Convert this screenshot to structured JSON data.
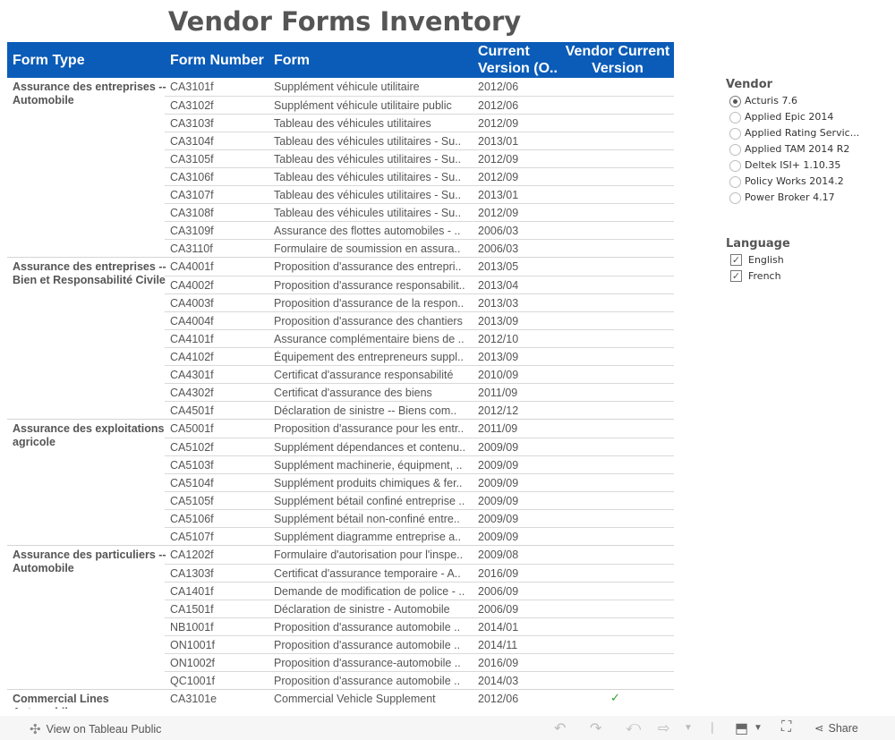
{
  "title": "Vendor Forms Inventory",
  "table": {
    "headers": {
      "form_type": "Form Type",
      "form_number": "Form Number",
      "form": "Form",
      "current_version": "Current Version (O..",
      "vendor_current_version": "Vendor Current Version"
    },
    "groups": [
      {
        "form_type": "Assurance des entreprises -- Automobile",
        "rows": [
          {
            "number": "CA3101f",
            "form": "Supplément véhicule utilitaire",
            "version": "2012/06",
            "vendor_current": ""
          },
          {
            "number": "CA3102f",
            "form": "Supplément véhicule utilitaire public",
            "version": "2012/06",
            "vendor_current": ""
          },
          {
            "number": "CA3103f",
            "form": "Tableau des véhicules utilitaires",
            "version": "2012/09",
            "vendor_current": ""
          },
          {
            "number": "CA3104f",
            "form": "Tableau des véhicules utilitaires - Su..",
            "version": "2013/01",
            "vendor_current": ""
          },
          {
            "number": "CA3105f",
            "form": "Tableau des véhicules utilitaires - Su..",
            "version": "2012/09",
            "vendor_current": ""
          },
          {
            "number": "CA3106f",
            "form": "Tableau des véhicules utilitaires - Su..",
            "version": "2012/09",
            "vendor_current": ""
          },
          {
            "number": "CA3107f",
            "form": "Tableau des véhicules utilitaires - Su..",
            "version": "2013/01",
            "vendor_current": ""
          },
          {
            "number": "CA3108f",
            "form": "Tableau des véhicules utilitaires - Su..",
            "version": "2012/09",
            "vendor_current": ""
          },
          {
            "number": "CA3109f",
            "form": "Assurance des flottes automobiles - ..",
            "version": "2006/03",
            "vendor_current": ""
          },
          {
            "number": "CA3110f",
            "form": "Formulaire de soumission en assura..",
            "version": "2006/03",
            "vendor_current": ""
          }
        ]
      },
      {
        "form_type": "Assurance des entreprises -- Bien et Responsabilité Civile",
        "rows": [
          {
            "number": "CA4001f",
            "form": "Proposition d'assurance des entrepri..",
            "version": "2013/05",
            "vendor_current": ""
          },
          {
            "number": "CA4002f",
            "form": "Proposition d'assurance responsabilit..",
            "version": "2013/04",
            "vendor_current": ""
          },
          {
            "number": "CA4003f",
            "form": "Proposition d'assurance de la respon..",
            "version": "2013/03",
            "vendor_current": ""
          },
          {
            "number": "CA4004f",
            "form": "Proposition d'assurance des chantiers",
            "version": "2013/09",
            "vendor_current": ""
          },
          {
            "number": "CA4101f",
            "form": "Assurance complémentaire biens de ..",
            "version": "2012/10",
            "vendor_current": ""
          },
          {
            "number": "CA4102f",
            "form": "Équipement des entrepreneurs suppl..",
            "version": "2013/09",
            "vendor_current": ""
          },
          {
            "number": "CA4301f",
            "form": "Certificat d'assurance responsabilité",
            "version": "2010/09",
            "vendor_current": ""
          },
          {
            "number": "CA4302f",
            "form": "Certificat d'assurance des biens",
            "version": "2011/09",
            "vendor_current": ""
          },
          {
            "number": "CA4501f",
            "form": "Déclaration de sinistre -- Biens com..",
            "version": "2012/12",
            "vendor_current": ""
          }
        ]
      },
      {
        "form_type": "Assurance des exploitations agricole",
        "rows": [
          {
            "number": "CA5001f",
            "form": "Proposition d'assurance pour les entr..",
            "version": "2011/09",
            "vendor_current": ""
          },
          {
            "number": "CA5102f",
            "form": "Supplément dépendances et contenu..",
            "version": "2009/09",
            "vendor_current": ""
          },
          {
            "number": "CA5103f",
            "form": "Supplément machinerie, équipment, ..",
            "version": "2009/09",
            "vendor_current": ""
          },
          {
            "number": "CA5104f",
            "form": "Supplément produits chimiques & fer..",
            "version": "2009/09",
            "vendor_current": ""
          },
          {
            "number": "CA5105f",
            "form": "Supplément bétail confiné entreprise ..",
            "version": "2009/09",
            "vendor_current": ""
          },
          {
            "number": "CA5106f",
            "form": "Supplément bétail non-confiné entre..",
            "version": "2009/09",
            "vendor_current": ""
          },
          {
            "number": "CA5107f",
            "form": "Supplément diagramme entreprise a..",
            "version": "2009/09",
            "vendor_current": ""
          }
        ]
      },
      {
        "form_type": "Assurance des particuliers -- Automobile",
        "rows": [
          {
            "number": "CA1202f",
            "form": "Formulaire d'autorisation pour l'inspe..",
            "version": "2009/08",
            "vendor_current": ""
          },
          {
            "number": "CA1303f",
            "form": "Certificat d'assurance temporaire - A..",
            "version": "2016/09",
            "vendor_current": ""
          },
          {
            "number": "CA1401f",
            "form": "Demande de modification de police - ..",
            "version": "2006/09",
            "vendor_current": ""
          },
          {
            "number": "CA1501f",
            "form": "Déclaration de sinistre - Automobile",
            "version": "2006/09",
            "vendor_current": ""
          },
          {
            "number": "NB1001f",
            "form": "Proposition d'assurance automobile ..",
            "version": "2014/01",
            "vendor_current": ""
          },
          {
            "number": "ON1001f",
            "form": "Proposition d'assurance automobile ..",
            "version": "2014/11",
            "vendor_current": ""
          },
          {
            "number": "ON1002f",
            "form": "Proposition d'assurance-automobile ..",
            "version": "2016/09",
            "vendor_current": ""
          },
          {
            "number": "QC1001f",
            "form": "Proposition d'assurance automobile ..",
            "version": "2014/03",
            "vendor_current": ""
          }
        ]
      },
      {
        "form_type": "Commercial Lines Automobile",
        "rows": [
          {
            "number": "CA3101e",
            "form": "Commercial Vehicle Supplement",
            "version": "2012/06",
            "vendor_current": "✓"
          }
        ]
      }
    ]
  },
  "filters": {
    "vendor": {
      "title": "Vendor",
      "selected": "Acturis 7.6",
      "options": [
        "Acturis 7.6",
        "Applied Epic 2014",
        "Applied Rating Servic...",
        "Applied TAM 2014 R2",
        "Deltek ISI+ 1.10.35",
        "Policy Works 2014.2",
        "Power Broker 4.17"
      ]
    },
    "language": {
      "title": "Language",
      "options": [
        {
          "label": "English",
          "checked": true
        },
        {
          "label": "French",
          "checked": true
        }
      ]
    }
  },
  "footer": {
    "view_on_label": "View on Tableau Public",
    "share_label": "Share",
    "icons": [
      "undo-icon",
      "redo-icon",
      "revert-icon",
      "refresh-icon",
      "dropdown-icon",
      "download-icon",
      "fullscreen-icon",
      "share-icon"
    ]
  },
  "colors": {
    "header_bg": "#0b5cb8",
    "check": "#2ea02e"
  }
}
